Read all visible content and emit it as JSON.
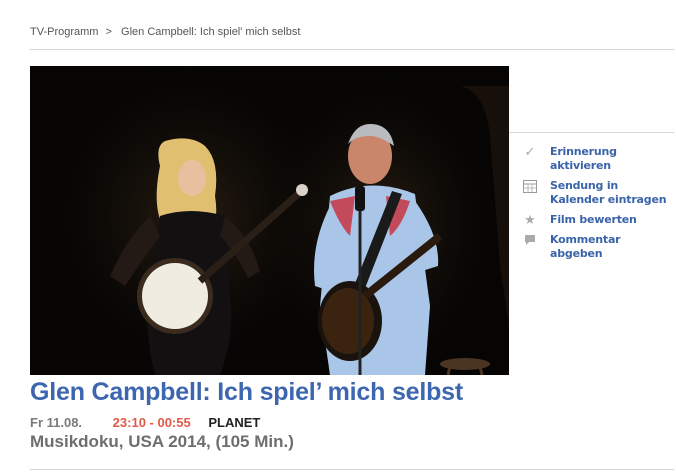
{
  "breadcrumb": {
    "root": "TV-Programm",
    "separator": ">",
    "current": "Glen Campbell: Ich spiel' mich selbst"
  },
  "hero": {
    "description": ""
  },
  "actions": [
    {
      "icon": "checkmark-icon",
      "label": "Erinnerung aktivieren"
    },
    {
      "icon": "calendar-icon",
      "label": "Sendung in Kalender eintragen"
    },
    {
      "icon": "star-icon",
      "label": "Film bewerten"
    },
    {
      "icon": "comment-icon",
      "label": "Kommentar abgeben"
    }
  ],
  "broadcast": {
    "title": "Glen Campbell: Ich spiel’ mich selbst",
    "date": "Fr 11.08.",
    "time": "23:10 - 00:55",
    "channel": "PLANET",
    "genre_line": "Musikdoku, USA 2014, (105 Min.)"
  },
  "colors": {
    "link_blue": "#3a64a8",
    "title_blue": "#3d66b0",
    "time_red": "#e05a4a"
  }
}
